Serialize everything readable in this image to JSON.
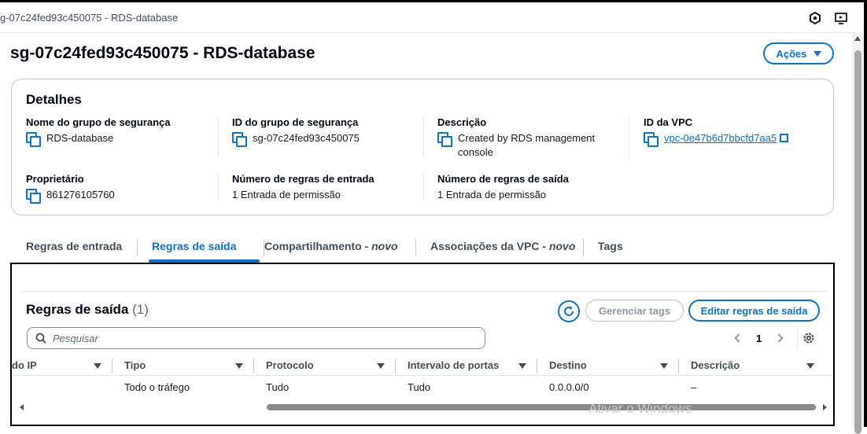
{
  "topbar": {
    "title": "g-07c24fed93c450075 - RDS-database"
  },
  "page": {
    "title": "sg-07c24fed93c450075 - RDS-database",
    "actions_label": "Ações"
  },
  "details": {
    "title": "Detalhes",
    "sg_name_label": "Nome do grupo de segurança",
    "sg_name_value": "RDS-database",
    "sg_id_label": "ID do grupo de segurança",
    "sg_id_value": "sg-07c24fed93c450075",
    "description_label": "Descrição",
    "description_value": "Created by RDS management console",
    "vpc_label": "ID da VPC",
    "vpc_value": "vpc-0e47b6d7bbcfd7aa5",
    "owner_label": "Proprietário",
    "owner_value": "861276105760",
    "inbound_count_label": "Número de regras de entrada",
    "inbound_count_value": "1 Entrada de permissão",
    "outbound_count_label": "Número de regras de saída",
    "outbound_count_value": "1 Entrada de permissão"
  },
  "tabs": [
    {
      "label": "Regras de entrada",
      "suffix": ""
    },
    {
      "label": "Regras de saída",
      "suffix": ""
    },
    {
      "label": "Compartilhamento - ",
      "suffix": "novo"
    },
    {
      "label": "Associações da VPC - ",
      "suffix": "novo"
    },
    {
      "label": "Tags",
      "suffix": ""
    }
  ],
  "outbound": {
    "title": "Regras de saída",
    "count": "(1)",
    "manage_tags_label": "Gerenciar tags",
    "edit_label": "Editar regras de saída",
    "search_placeholder": "Pesquisar",
    "page": "1",
    "columns": [
      "do IP",
      "Tipo",
      "Protocolo",
      "Intervalo de portas",
      "Destino",
      "Descrição"
    ],
    "rows": [
      {
        "ip": "",
        "type": "Todo o tráfego",
        "protocol": "Tudo",
        "ports": "Tudo",
        "destination": "0.0.0.0/0",
        "description": "–"
      }
    ]
  },
  "watermark": "Ativar o Windows",
  "colors": {
    "accent": "#0972d3",
    "text": "#16191f",
    "border": "#c6c6cd"
  }
}
